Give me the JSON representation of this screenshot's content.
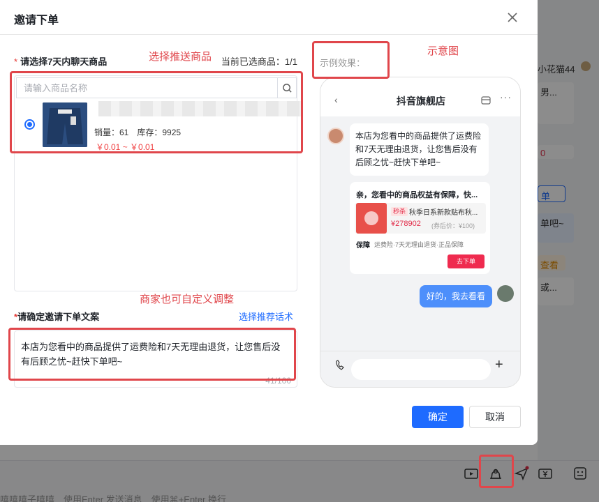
{
  "modal": {
    "title": "邀请下单",
    "section1_required": "*",
    "section1_label": "请选择7天内聊天商品",
    "selected_count": "当前已选商品：1/1",
    "search": {
      "placeholder": "请输入商品名称"
    },
    "product": {
      "stats": "销量：61　库存：9925",
      "price": "￥0.01 ~ ￥0.01",
      "selected": true
    },
    "section2_required": "*",
    "section2_label": "请确定邀请下单文案",
    "recommend_link": "选择推荐话术",
    "message_text": "本店为您看中的商品提供了运费险和7天无理由退货，让您售后没有后顾之忧~赶快下单吧~",
    "char_count": "41/100",
    "confirm_label": "确定",
    "cancel_label": "取消",
    "example_label": "示例效果："
  },
  "preview": {
    "store_title": "抖音旗舰店",
    "back_glyph": "‹",
    "more_glyph": "···",
    "store_message": "本店为您看中的商品提供了运费险和7天无理由退货，让您售后没有后顾之忧~赶快下单吧~",
    "card_title": "亲，您看中的商品权益有保障，快...",
    "tag": "秒杀",
    "item_name": "秋季日系新款贴布秋...",
    "item_price": "¥278902",
    "item_after": "(券后价：¥100)",
    "guarantee_tag": "保障",
    "guarantee_text": "运费险·7天无理由退货·正品保障",
    "go_order_label": "去下单",
    "user_reply": "好的，我去看看",
    "plus_glyph": "+"
  },
  "annotations": {
    "select_product": "选择推送商品",
    "schematic": "示意图",
    "customize": "商家也可自定义调整"
  },
  "background": {
    "username": "小花猫44",
    "card1": "男...",
    "card2": "0",
    "card3": "单",
    "card4": "单吧~",
    "card5": "查看",
    "card6": "或...",
    "input_hint": "嘻嘻嘻子嘻嘻　使用Enter 发送消息　使用⌘+Enter 换行"
  },
  "colors": {
    "primary": "#1e6bff",
    "price_red": "#f04142",
    "annotation_red": "#e0464b",
    "preview_bubble_blue": "#4d8ffb"
  }
}
